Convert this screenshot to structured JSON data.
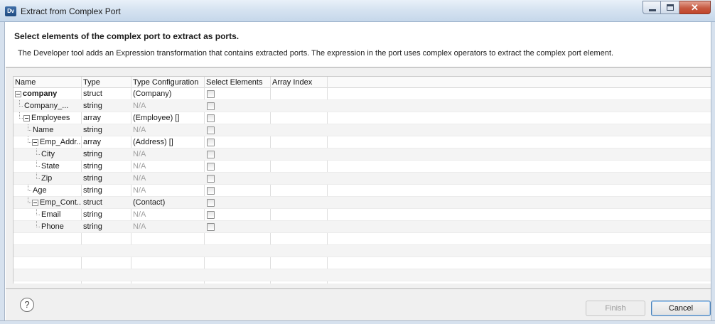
{
  "window": {
    "app_icon": "Dv",
    "title": "Extract from Complex Port"
  },
  "header": {
    "title": "Select elements of the complex port to extract as ports.",
    "description": "The Developer tool adds an Expression transformation that contains extracted ports. The expression in the port uses complex operators to extract the complex port element."
  },
  "table": {
    "columns": [
      "Name",
      "Type",
      "Type Configuration",
      "Select Elements",
      "Array Index"
    ],
    "rows": [
      {
        "name": "company",
        "type": "struct",
        "config": "(Company)",
        "depth": 0,
        "expandable": true
      },
      {
        "name": "Company_...",
        "type": "string",
        "config": "N/A",
        "depth": 1,
        "expandable": false
      },
      {
        "name": "Employees",
        "type": "array",
        "config": "(Employee) []",
        "depth": 1,
        "expandable": true
      },
      {
        "name": "Name",
        "type": "string",
        "config": "N/A",
        "depth": 2,
        "expandable": false
      },
      {
        "name": "Emp_Addr...",
        "type": "array",
        "config": "(Address) []",
        "depth": 2,
        "expandable": true
      },
      {
        "name": "City",
        "type": "string",
        "config": "N/A",
        "depth": 3,
        "expandable": false
      },
      {
        "name": "State",
        "type": "string",
        "config": "N/A",
        "depth": 3,
        "expandable": false
      },
      {
        "name": "Zip",
        "type": "string",
        "config": "N/A",
        "depth": 3,
        "expandable": false
      },
      {
        "name": "Age",
        "type": "string",
        "config": "N/A",
        "depth": 2,
        "expandable": false
      },
      {
        "name": "Emp_Cont...",
        "type": "struct",
        "config": "(Contact)",
        "depth": 2,
        "expandable": true
      },
      {
        "name": "Email",
        "type": "string",
        "config": "N/A",
        "depth": 3,
        "expandable": false
      },
      {
        "name": "Phone",
        "type": "string",
        "config": "N/A",
        "depth": 3,
        "expandable": false
      }
    ]
  },
  "footer": {
    "help_icon": "?",
    "finish_label": "Finish",
    "cancel_label": "Cancel"
  },
  "icons": {
    "minimize": "minimize-icon",
    "maximize": "maximize-icon",
    "close": "close-icon",
    "help": "help-icon"
  }
}
